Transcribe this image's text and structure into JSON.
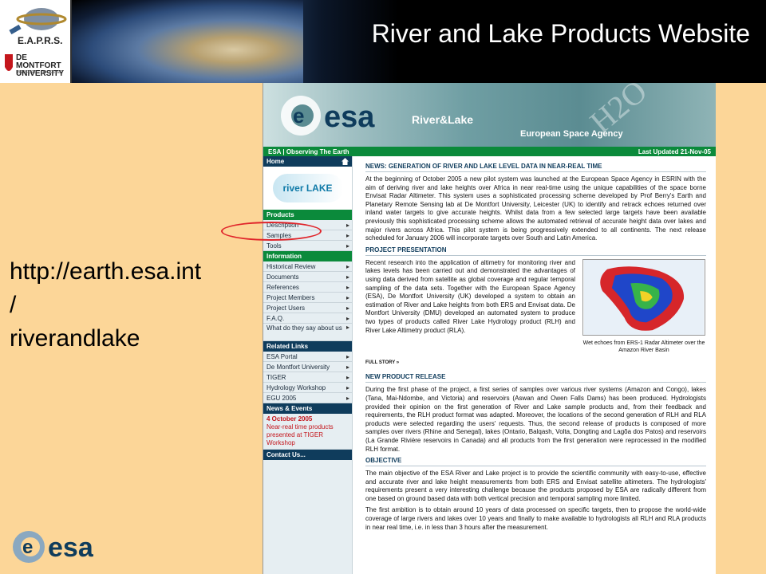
{
  "slide": {
    "title": "River and Lake Products Website",
    "url": "http://earth.esa.int\n/\nriverandlake",
    "logos": {
      "eaprs": "E.A.P.R.S.",
      "dmu_line1": "DE MONTFORT",
      "dmu_line2": "UNIVERSITY",
      "dmu_sub": "BEDFORD · LEICESTER",
      "esa": "esa"
    }
  },
  "site": {
    "banner": {
      "brand": "esa",
      "section": "River&Lake",
      "agency": "European Space Agency",
      "decor": "H2O"
    },
    "topbar": {
      "left": "ESA | Observing The Earth",
      "right": "Last Updated 21-Nov-05"
    },
    "sidebar": {
      "home": "Home",
      "logo_text": "river LAKE",
      "products": "Products",
      "product_items": [
        "Description",
        "Samples",
        "Tools"
      ],
      "information": "Information",
      "info_items": [
        "Historical Review",
        "Documents",
        "References",
        "Project Members",
        "Project Users",
        "F.A.Q.",
        "What do they say about us"
      ],
      "related": "Related Links",
      "related_items": [
        "ESA Portal",
        "De Montfort University",
        "TIGER",
        "Hydrology Workshop",
        "EGU 2005"
      ],
      "news": "News & Events",
      "news_date": "4 October 2005",
      "news_text": "Near-real time products presented at TIGER Workshop",
      "contact": "Contact Us..."
    },
    "content": {
      "news_heading": "NEWS: GENERATION OF RIVER AND LAKE LEVEL DATA IN NEAR-REAL TIME",
      "news_text": "At the beginning of October 2005 a new pilot system was launched at the European Space Agency in ESRIN with the aim of deriving river and lake heights over Africa in near real-time using the unique capabilities of the space borne Envisat Radar Altimeter. This system uses a sophisticated processing scheme developed by Prof Berry's Earth and Planetary Remote Sensing lab at De Montfort University, Leicester (UK) to identify and retrack echoes returned over inland water targets to give accurate heights. Whilst data from a few selected large targets have been available previously this sophisticated processing scheme allows the automated retrieval of accurate height data over lakes and major rivers across Africa. This pilot system is being progressively extended to all continents. The next release scheduled for January 2006 will incorporate targets over South and Latin America.",
      "pp_heading": "PROJECT PRESENTATION",
      "pp_text": "Recent research into the application of altimetry for monitoring river and lakes levels has been carried out and demonstrated the advantages of using data derived from satellite as global coverage and regular temporal sampling of the data sets. Together with the European Space Agency (ESA), De Montfort University (UK) developed a system to obtain an estimation of River and Lake heights from both ERS and Envisat data. De Montfort University (DMU) developed an automated system to produce two types of products called River Lake Hydrology product (RLH) and River Lake Altimetry product (RLA).",
      "map_caption": "Wet echoes from ERS-1 Radar Altimeter over the Amazon River Basin",
      "full_story": "FULL STORY »",
      "npr_heading": "NEW PRODUCT RELEASE",
      "npr_text": "During the first phase of the project, a first series of samples over various river systems (Amazon and Congo), lakes (Tana, Mai-Ndombe, and Victoria) and reservoirs (Aswan and Owen Falls Dams) has been produced. Hydrologists provided their opinion on the first generation of River and Lake sample products and, from their feedback and requirements, the RLH product format was adapted. Moreover, the locations of the second generation of RLH and RLA products were selected regarding the users' requests. Thus, the second release of products is composed of more samples over rivers (Rhine and Senegal), lakes (Ontario, Balqash, Volta, Dongting and Lagõa dos Patos) and reservoirs (La Grande Rivière reservoirs in Canada) and all products from the first generation were reprocessed in the modified RLH format.",
      "obj_heading": "OBJECTIVE",
      "obj_text1": "The main objective of the ESA River and Lake project is to provide the scientific community with easy-to-use, effective and accurate river and lake height measurements from both ERS and Envisat satellite altimeters. The hydrologists' requirements present a very interesting challenge because the products proposed by ESA are radically different from one based on ground based data with both vertical precision and temporal sampling more limited.",
      "obj_text2": "The first ambition is to obtain around 10 years of data processed on specific targets, then to propose the world-wide coverage of large rivers and lakes over 10 years and finally to make available to hydrologists all RLH and RLA products in near real time, i.e. in less than 3 hours after the measurement."
    }
  }
}
